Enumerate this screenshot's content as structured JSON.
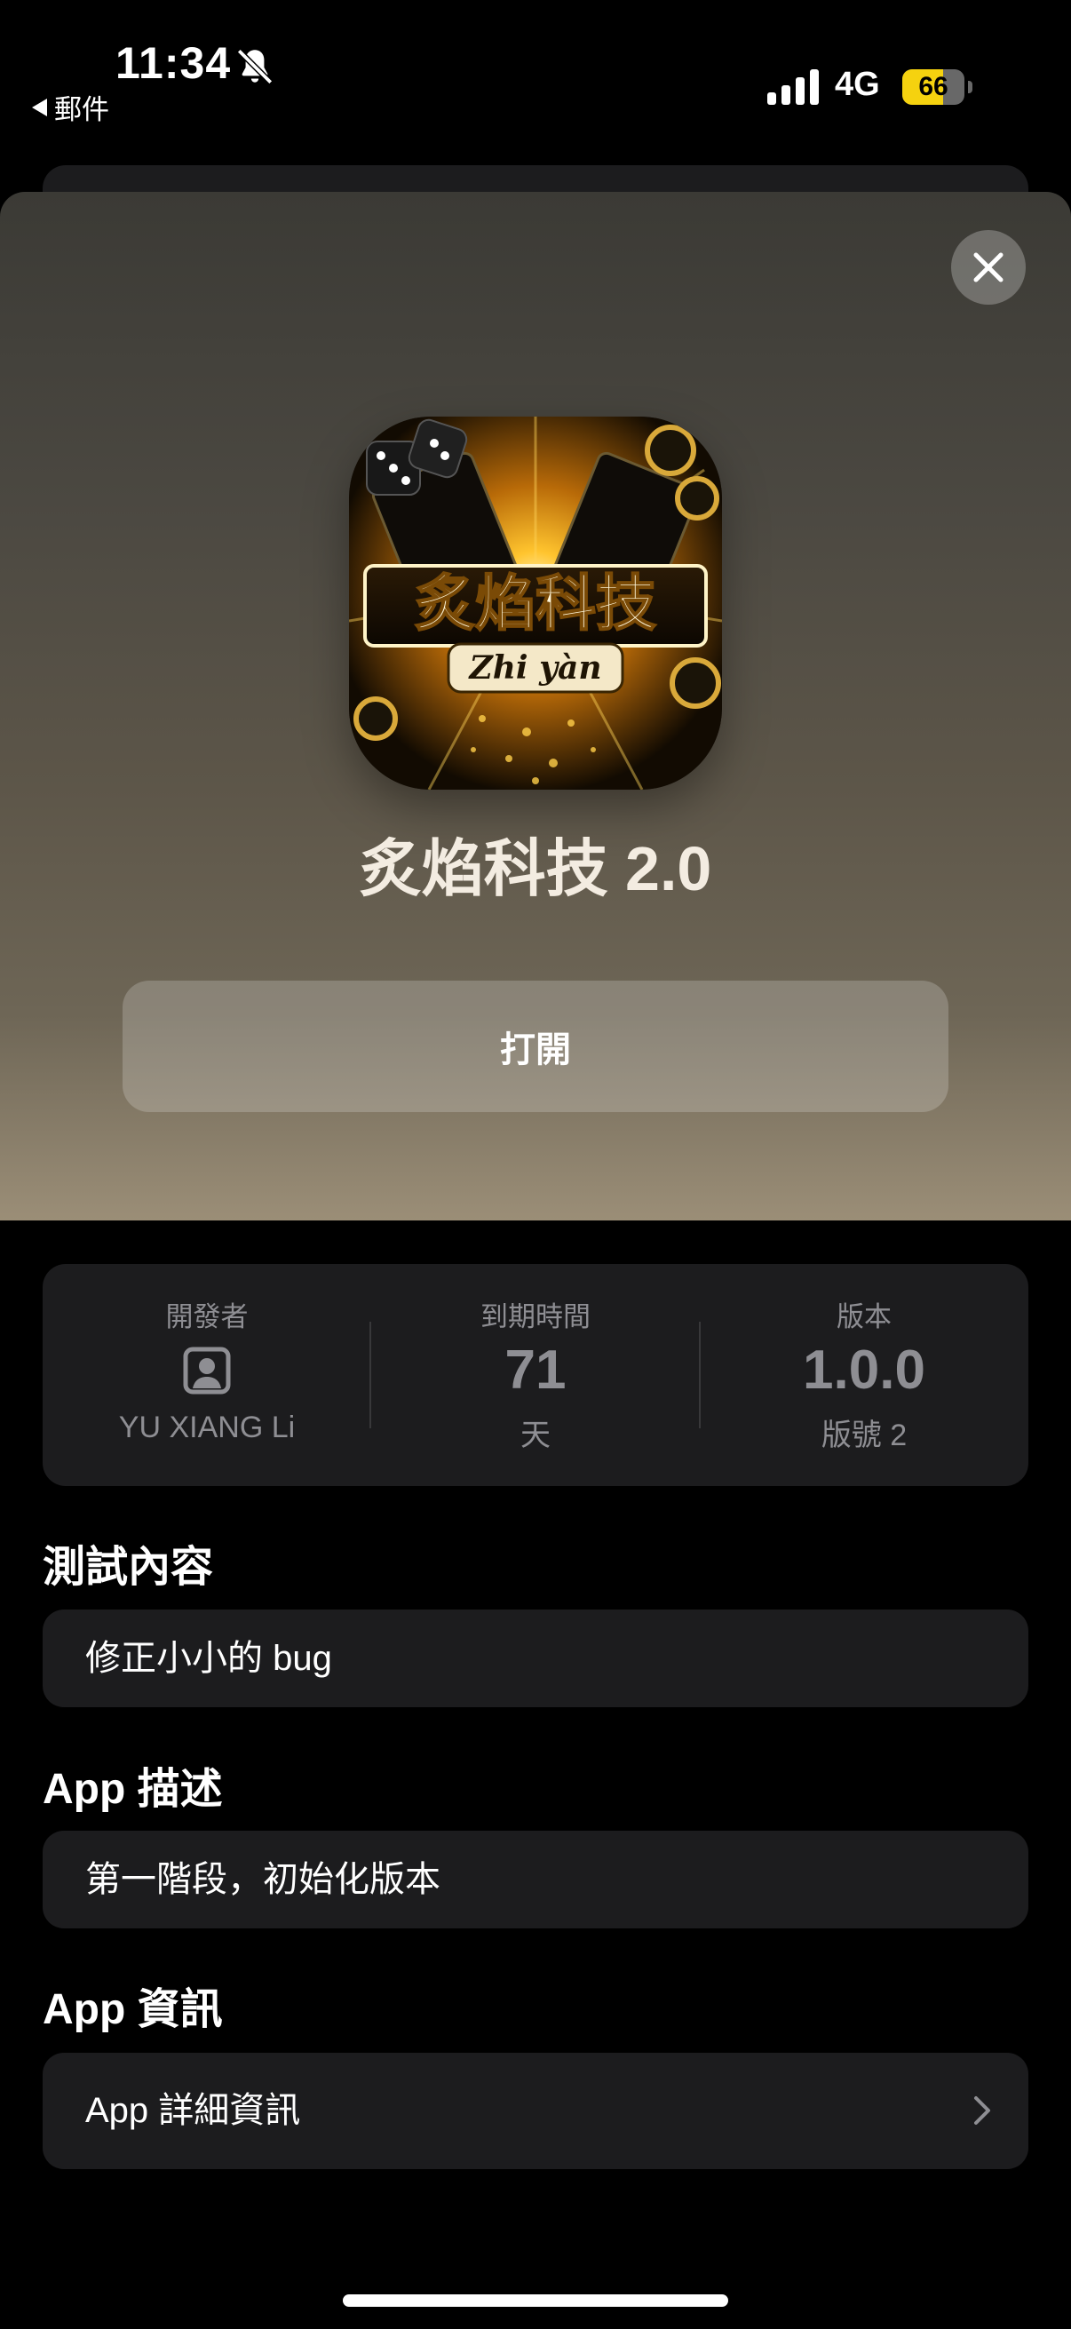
{
  "status_bar": {
    "time": "11:34",
    "back_app": "郵件",
    "network": "4G",
    "battery": "66",
    "battery_level": 0.66
  },
  "app": {
    "name": "炙焰科技 2.0",
    "icon_title": "炙焰科技",
    "icon_subtitle": "Zhi yàn",
    "open_label": "打開"
  },
  "info": {
    "developer_label": "開發者",
    "developer_name": "YU XIANG Li",
    "expiry_label": "到期時間",
    "expiry_value": "71",
    "expiry_unit": "天",
    "version_label": "版本",
    "version_value": "1.0.0",
    "build_label": "版號 2"
  },
  "sections": {
    "test_title": "測試內容",
    "test_content": "修正小小的 bug",
    "desc_title": "App 描述",
    "desc_content": "第一階段，初始化版本",
    "info_title": "App 資訊",
    "info_row": "App 詳細資訊"
  },
  "colors": {
    "background": "#000000",
    "card": "#1c1c1e",
    "secondary_text": "#8e8e93",
    "battery_yellow": "#f5d20f"
  }
}
